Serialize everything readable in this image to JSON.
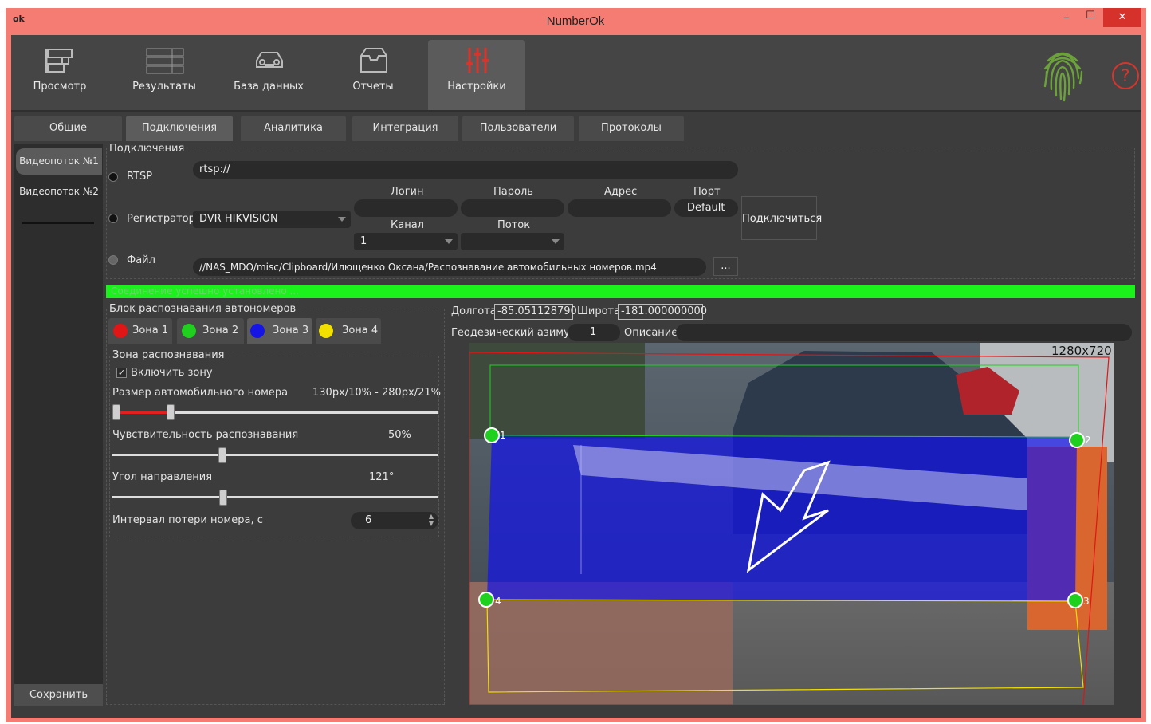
{
  "window": {
    "title": "NumberOk",
    "icon_text": "ok",
    "minimize": "–",
    "maximize": "☐",
    "close": "✕"
  },
  "toolbar": {
    "items": [
      {
        "label": "Просмотр",
        "icon": "camera-icon"
      },
      {
        "label": "Результаты",
        "icon": "results-list-icon"
      },
      {
        "label": "База данных",
        "icon": "car-database-icon"
      },
      {
        "label": "Отчеты",
        "icon": "reports-box-icon"
      },
      {
        "label": "Настройки",
        "icon": "settings-sliders-icon"
      }
    ],
    "help": "?"
  },
  "tabs": [
    "Общие",
    "Подключения",
    "Аналитика",
    "Интеграция",
    "Пользователи",
    "Протоколы"
  ],
  "left": {
    "stream1": "Видеопоток №1",
    "stream2": "Видеопоток №2",
    "save": "Сохранить"
  },
  "connection": {
    "group": "Подключения",
    "rtsp_label": "RTSP",
    "rtsp_value": "rtsp://",
    "recorder_label": "Регистратор",
    "recorder_value": "DVR HIKVISION",
    "login_label": "Логин",
    "password_label": "Пароль",
    "address_label": "Адрес",
    "port_label": "Порт",
    "port_value": "Default",
    "channel_label": "Канал",
    "channel_value": "1",
    "stream_label": "Поток",
    "stream_value": "",
    "connect_button": "Подключиться",
    "file_label": "Файл",
    "file_value": "//NAS_MDO/misc/Clipboard/Илющенко Оксана/Распознавание автомобильных номеров.mp4",
    "browse": "..."
  },
  "status": "Соединение успешно установлено ...",
  "recognition": {
    "group": "Блок распознавания автономеров",
    "zones": [
      {
        "label": "Зона 1",
        "color": "#e01515"
      },
      {
        "label": "Зона 2",
        "color": "#1fd01f"
      },
      {
        "label": "Зона 3",
        "color": "#1414e6"
      },
      {
        "label": "Зона 4",
        "color": "#f2e000"
      }
    ],
    "zone_group": "Зона распознавания",
    "enable_zone": "Включить зону",
    "enable_zone_checked": true,
    "plate_size_label": "Размер автомобильного номера",
    "plate_size_value": "130px/10% - 280px/21%",
    "sensitivity_label": "Чувствительность распознавания",
    "sensitivity_value": "50%",
    "direction_label": "Угол направления",
    "direction_value": "121°",
    "interval_label": "Интервал потери номера, с",
    "interval_value": "6"
  },
  "geo": {
    "longitude_label": "Долгота",
    "longitude_value": "-85.051128790",
    "latitude_label": "Широта",
    "latitude_value": "-181.000000000",
    "azimuth_label": "Геодезический азимут",
    "azimuth_value": "1",
    "description_label": "Описание",
    "description_value": ""
  },
  "video": {
    "resolution": "1280x720",
    "points": [
      "1",
      "2",
      "3",
      "4"
    ]
  }
}
